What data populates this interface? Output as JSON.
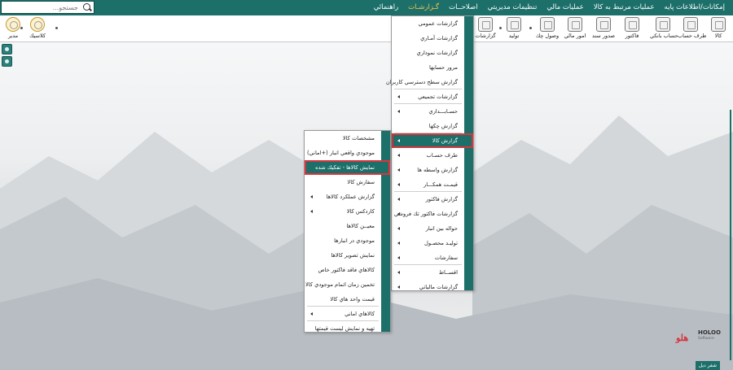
{
  "search": {
    "placeholder": "جستجو..."
  },
  "menubar": {
    "items": [
      {
        "label": "إمكانات/اطلاعات پايه",
        "active": false
      },
      {
        "label": "عمليات مرتبط به كالا",
        "active": false
      },
      {
        "label": "عمليات مالي",
        "active": false
      },
      {
        "label": "تنظيمات مديريتي",
        "active": false
      },
      {
        "label": "اصلاحــات",
        "active": false
      },
      {
        "label": "گـزارشـات",
        "active": true
      },
      {
        "label": "راهنمائي",
        "active": false
      }
    ]
  },
  "toolbar": {
    "items": [
      {
        "label": "كالا",
        "icon": "box-icon"
      },
      {
        "label": "طرف حساب",
        "icon": "person-icon"
      },
      {
        "label": "حساب بانكي",
        "icon": "bank-icon"
      },
      {
        "label": "فاكتور",
        "icon": "invoice-icon"
      },
      {
        "label": "صدور سند",
        "icon": "document-icon"
      },
      {
        "label": "امور مالي",
        "icon": "calculator-icon"
      },
      {
        "label": "وصول چك",
        "icon": "check-icon"
      },
      {
        "label": "توليد",
        "icon": "factory-icon"
      },
      {
        "label": "گزارشات",
        "icon": "report-icon"
      }
    ],
    "left_items": [
      {
        "label": "كلاسيك",
        "icon": "palette-icon"
      },
      {
        "label": "مدير",
        "icon": "admin-icon"
      }
    ]
  },
  "reports_menu": {
    "items": [
      {
        "label": "گزارشات عمومي",
        "submenu": false,
        "sep": false
      },
      {
        "label": "گزارشات آمـاري",
        "submenu": false,
        "sep": false
      },
      {
        "label": "گزارشات نموداري",
        "submenu": false,
        "sep": false
      },
      {
        "label": "مرور حسابها",
        "submenu": false,
        "sep": false
      },
      {
        "label": "گزارش سطح دسترسي كاربران",
        "submenu": false,
        "sep": true
      },
      {
        "label": "گزارشات تجميعي",
        "submenu": true,
        "sep": true
      },
      {
        "label": "حسـابـــداري",
        "submenu": true,
        "sep": false
      },
      {
        "label": "گزارش چكها",
        "submenu": false,
        "sep": true
      },
      {
        "label": "گزارش كالا",
        "submenu": true,
        "sep": false,
        "highlight": true
      },
      {
        "label": "طرف حسـاب",
        "submenu": true,
        "sep": false
      },
      {
        "label": "گزارش واسطه ها",
        "submenu": true,
        "sep": false
      },
      {
        "label": "قيمـت همكـــار",
        "submenu": true,
        "sep": true
      },
      {
        "label": "گزارش فاكتور",
        "submenu": true,
        "sep": false
      },
      {
        "label": "گزارشات فاكتور تك فروشي",
        "submenu": true,
        "sep": false
      },
      {
        "label": "حواله بين انبار",
        "submenu": true,
        "sep": false
      },
      {
        "label": "توليـد محصـول",
        "submenu": true,
        "sep": false
      },
      {
        "label": "سفارشات",
        "submenu": true,
        "sep": true
      },
      {
        "label": "اقســاط",
        "submenu": true,
        "sep": false
      },
      {
        "label": "گزارشات مالياتي",
        "submenu": true,
        "sep": false
      }
    ]
  },
  "goods_menu": {
    "items": [
      {
        "label": "مشخصات كالا",
        "submenu": false,
        "sep": false
      },
      {
        "label": "موجودي واقعي انبار (+اماني)",
        "submenu": false,
        "sep": false
      },
      {
        "label": "نمايش كالاها - تفكيك شده",
        "submenu": false,
        "sep": false,
        "highlight": true
      },
      {
        "label": "سفارش كالا",
        "submenu": false,
        "sep": false
      },
      {
        "label": "گزارش عملكرد كالاها",
        "submenu": true,
        "sep": false
      },
      {
        "label": "كاردكس كالا",
        "submenu": true,
        "sep": false
      },
      {
        "label": "معيــن كالاها",
        "submenu": false,
        "sep": false
      },
      {
        "label": "موجودي در انبارها",
        "submenu": false,
        "sep": false
      },
      {
        "label": "نمايش تصوير كالاها",
        "submenu": false,
        "sep": false
      },
      {
        "label": "كالاهاي فاقد فاكتور خاص",
        "submenu": false,
        "sep": false
      },
      {
        "label": "تخمين زمان اتمام موجودي كالا",
        "submenu": false,
        "sep": false
      },
      {
        "label": "قيمت واحد هاي كالا",
        "submenu": false,
        "sep": true
      },
      {
        "label": "كالاهاي اماني",
        "submenu": true,
        "sep": true
      },
      {
        "label": "تهيه و نمايش ليست قيمتها",
        "submenu": false,
        "sep": false
      }
    ]
  },
  "logo": {
    "mark": "هلو",
    "name": "HOLOO",
    "sub": "Software"
  },
  "status": {
    "text": "شفر ديل"
  },
  "colors": {
    "primary": "#1d6f6a",
    "active_menu": "#f6c548",
    "highlight_border": "#d9353d"
  }
}
